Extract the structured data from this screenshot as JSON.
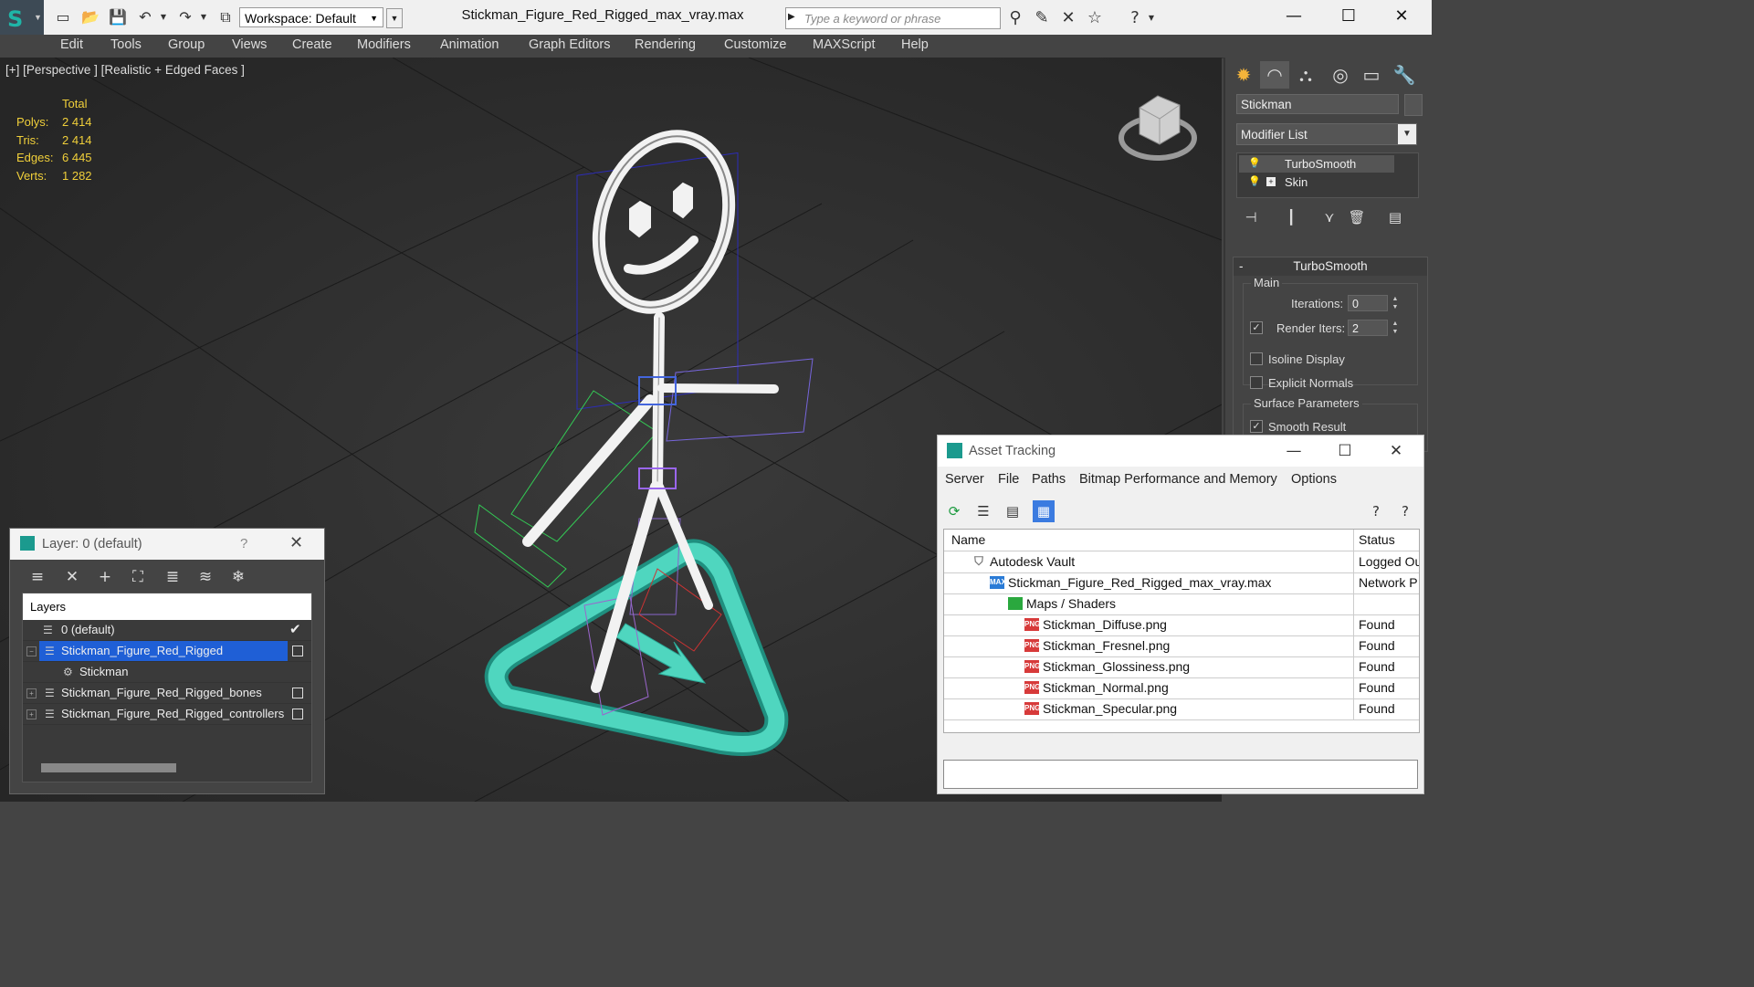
{
  "window": {
    "title": "Stickman_Figure_Red_Rigged_max_vray.max",
    "workspace": "Workspace: Default",
    "search_placeholder": "Type a keyword or phrase"
  },
  "menu": [
    "Edit",
    "Tools",
    "Group",
    "Views",
    "Create",
    "Modifiers",
    "Animation",
    "Graph Editors",
    "Rendering",
    "Customize",
    "MAXScript",
    "Help"
  ],
  "viewport": {
    "label": "[+] [Perspective ] [Realistic + Edged Faces ]",
    "stats": {
      "header": "Total",
      "rows": [
        {
          "label": "Polys:",
          "value": "2 414"
        },
        {
          "label": "Tris:",
          "value": "2 414"
        },
        {
          "label": "Edges:",
          "value": "6 445"
        },
        {
          "label": "Verts:",
          "value": "1 282"
        }
      ]
    }
  },
  "command_panel": {
    "object_name": "Stickman",
    "modifier_list": "Modifier List",
    "stack": [
      "TurboSmooth",
      "Skin"
    ],
    "rollout_title": "TurboSmooth",
    "main_group": "Main",
    "iterations_label": "Iterations:",
    "iterations_value": "0",
    "render_iters_label": "Render Iters:",
    "render_iters_value": "2",
    "isoline_label": "Isoline Display",
    "explicit_normals_label": "Explicit Normals",
    "surface_group": "Surface Parameters",
    "smooth_result_label": "Smooth Result"
  },
  "layer_dialog": {
    "title": "Layer: 0 (default)",
    "help": "?",
    "column_header": "Layers",
    "rows": [
      {
        "name": "0 (default)"
      },
      {
        "name": "Stickman_Figure_Red_Rigged"
      },
      {
        "name": "Stickman"
      },
      {
        "name": "Stickman_Figure_Red_Rigged_bones"
      },
      {
        "name": "Stickman_Figure_Red_Rigged_controllers"
      }
    ]
  },
  "asset_tracking": {
    "title": "Asset Tracking",
    "menu": [
      "Server",
      "File",
      "Paths",
      "Bitmap Performance and Memory",
      "Options"
    ],
    "columns": {
      "name": "Name",
      "status": "Status"
    },
    "rows": [
      {
        "name": "Autodesk Vault",
        "status": "Logged Ou"
      },
      {
        "name": "Stickman_Figure_Red_Rigged_max_vray.max",
        "status": "Network P"
      },
      {
        "name": "Maps / Shaders",
        "status": ""
      },
      {
        "name": "Stickman_Diffuse.png",
        "status": "Found"
      },
      {
        "name": "Stickman_Fresnel.png",
        "status": "Found"
      },
      {
        "name": "Stickman_Glossiness.png",
        "status": "Found"
      },
      {
        "name": "Stickman_Normal.png",
        "status": "Found"
      },
      {
        "name": "Stickman_Specular.png",
        "status": "Found"
      }
    ],
    "file_badge": "MAX",
    "png_badge": "PNG"
  },
  "colors": {
    "accent_teal": "#1fb5a7",
    "selection_blue": "#1f5fd6",
    "stats_yellow": "#f0cf3a",
    "controller_teal": "#4fd6bf"
  },
  "icons": {
    "title_toolbar": [
      "new-file-icon",
      "open-file-icon",
      "save-icon",
      "undo-icon",
      "redo-icon",
      "project-icon"
    ],
    "info_center": [
      "binoculars-icon",
      "key-tools-icon",
      "exchange-icon",
      "favorites-star-icon",
      "help-icon"
    ],
    "command_tabs": [
      "create-icon",
      "modify-icon",
      "hierarchy-icon",
      "motion-icon",
      "display-icon",
      "utilities-icon"
    ]
  }
}
